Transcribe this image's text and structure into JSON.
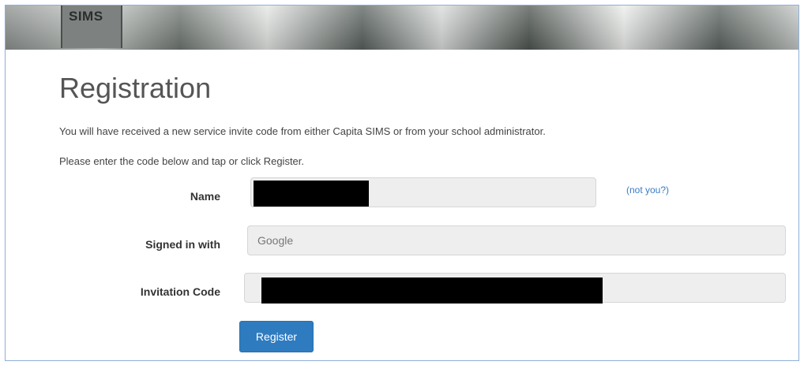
{
  "header": {
    "logo_text": "SIMS"
  },
  "page": {
    "title": "Registration",
    "intro_line1": "You will have received a new service invite code from either Capita SIMS or from your school administrator.",
    "intro_line2": "Please enter the code below and tap or click Register."
  },
  "form": {
    "name_label": "Name",
    "name_value": "",
    "not_you_link": "(not you?)",
    "signed_in_label": "Signed in with",
    "signed_in_value": "Google",
    "invitation_label": "Invitation Code",
    "invitation_value": "",
    "register_button": "Register"
  },
  "colors": {
    "accent": "#2f7bbf",
    "link": "#3a7cc4",
    "field_bg": "#eeeeee",
    "redaction": "#000000"
  }
}
